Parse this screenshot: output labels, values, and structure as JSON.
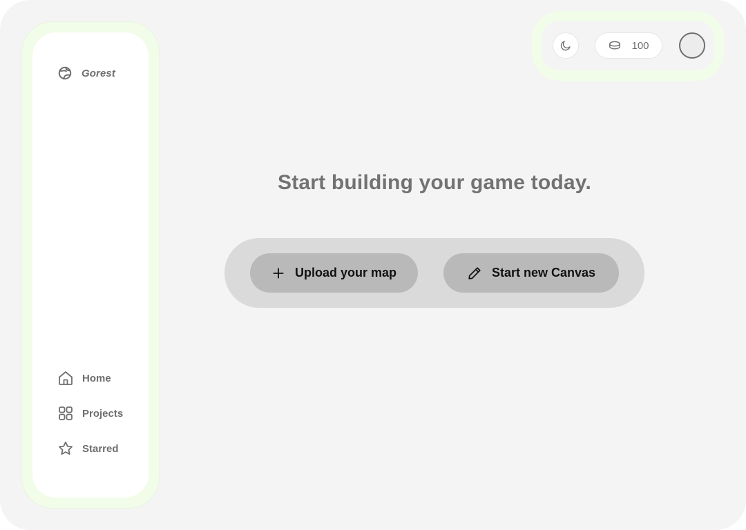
{
  "brand": {
    "name": "Gorest",
    "logo_icon": "brand-logo-icon"
  },
  "sidebar": {
    "items": [
      {
        "label": "Home",
        "icon": "home-icon"
      },
      {
        "label": "Projects",
        "icon": "grid-icon"
      },
      {
        "label": "Starred",
        "icon": "star-icon"
      }
    ]
  },
  "topbar": {
    "theme_icon": "moon-icon",
    "coin_icon": "coin-icon",
    "coin_count": "100",
    "avatar_icon": "avatar"
  },
  "main": {
    "headline": "Start building your game today.",
    "upload_label": "Upload your map",
    "upload_icon": "plus-icon",
    "canvas_label": "Start new Canvas",
    "canvas_icon": "pencil-icon"
  },
  "colors": {
    "background": "#f4f4f4",
    "accent_glow": "#f1fde8",
    "text_gray": "#6e6e6e",
    "tray": "#dadada",
    "button": "#b9b9b9"
  }
}
